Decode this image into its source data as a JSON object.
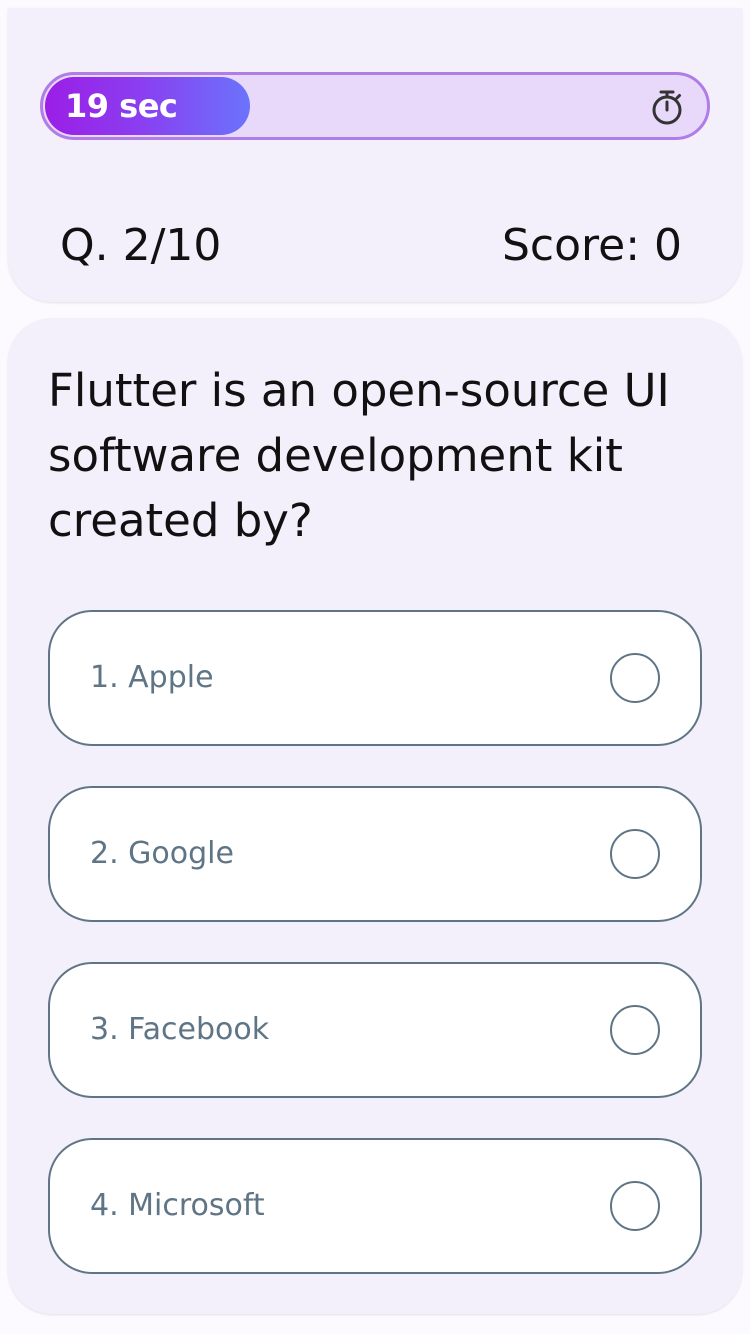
{
  "timer": {
    "label": "19 sec",
    "remaining_fraction": 0.31,
    "icon": "stopwatch-icon"
  },
  "status": {
    "question_counter": "Q. 2/10",
    "score": "Score: 0"
  },
  "question": {
    "text": "Flutter is an open-source UI software development kit created by?"
  },
  "options": [
    {
      "label": "1. Apple",
      "selected": false
    },
    {
      "label": "2. Google",
      "selected": false
    },
    {
      "label": "3. Facebook",
      "selected": false
    },
    {
      "label": "4. Microsoft",
      "selected": false
    }
  ],
  "colors": {
    "accent_purple": "#9b1ee6",
    "accent_blue": "#6b73fb",
    "timer_track": "#e8d9fb",
    "option_border": "#5f7585"
  }
}
